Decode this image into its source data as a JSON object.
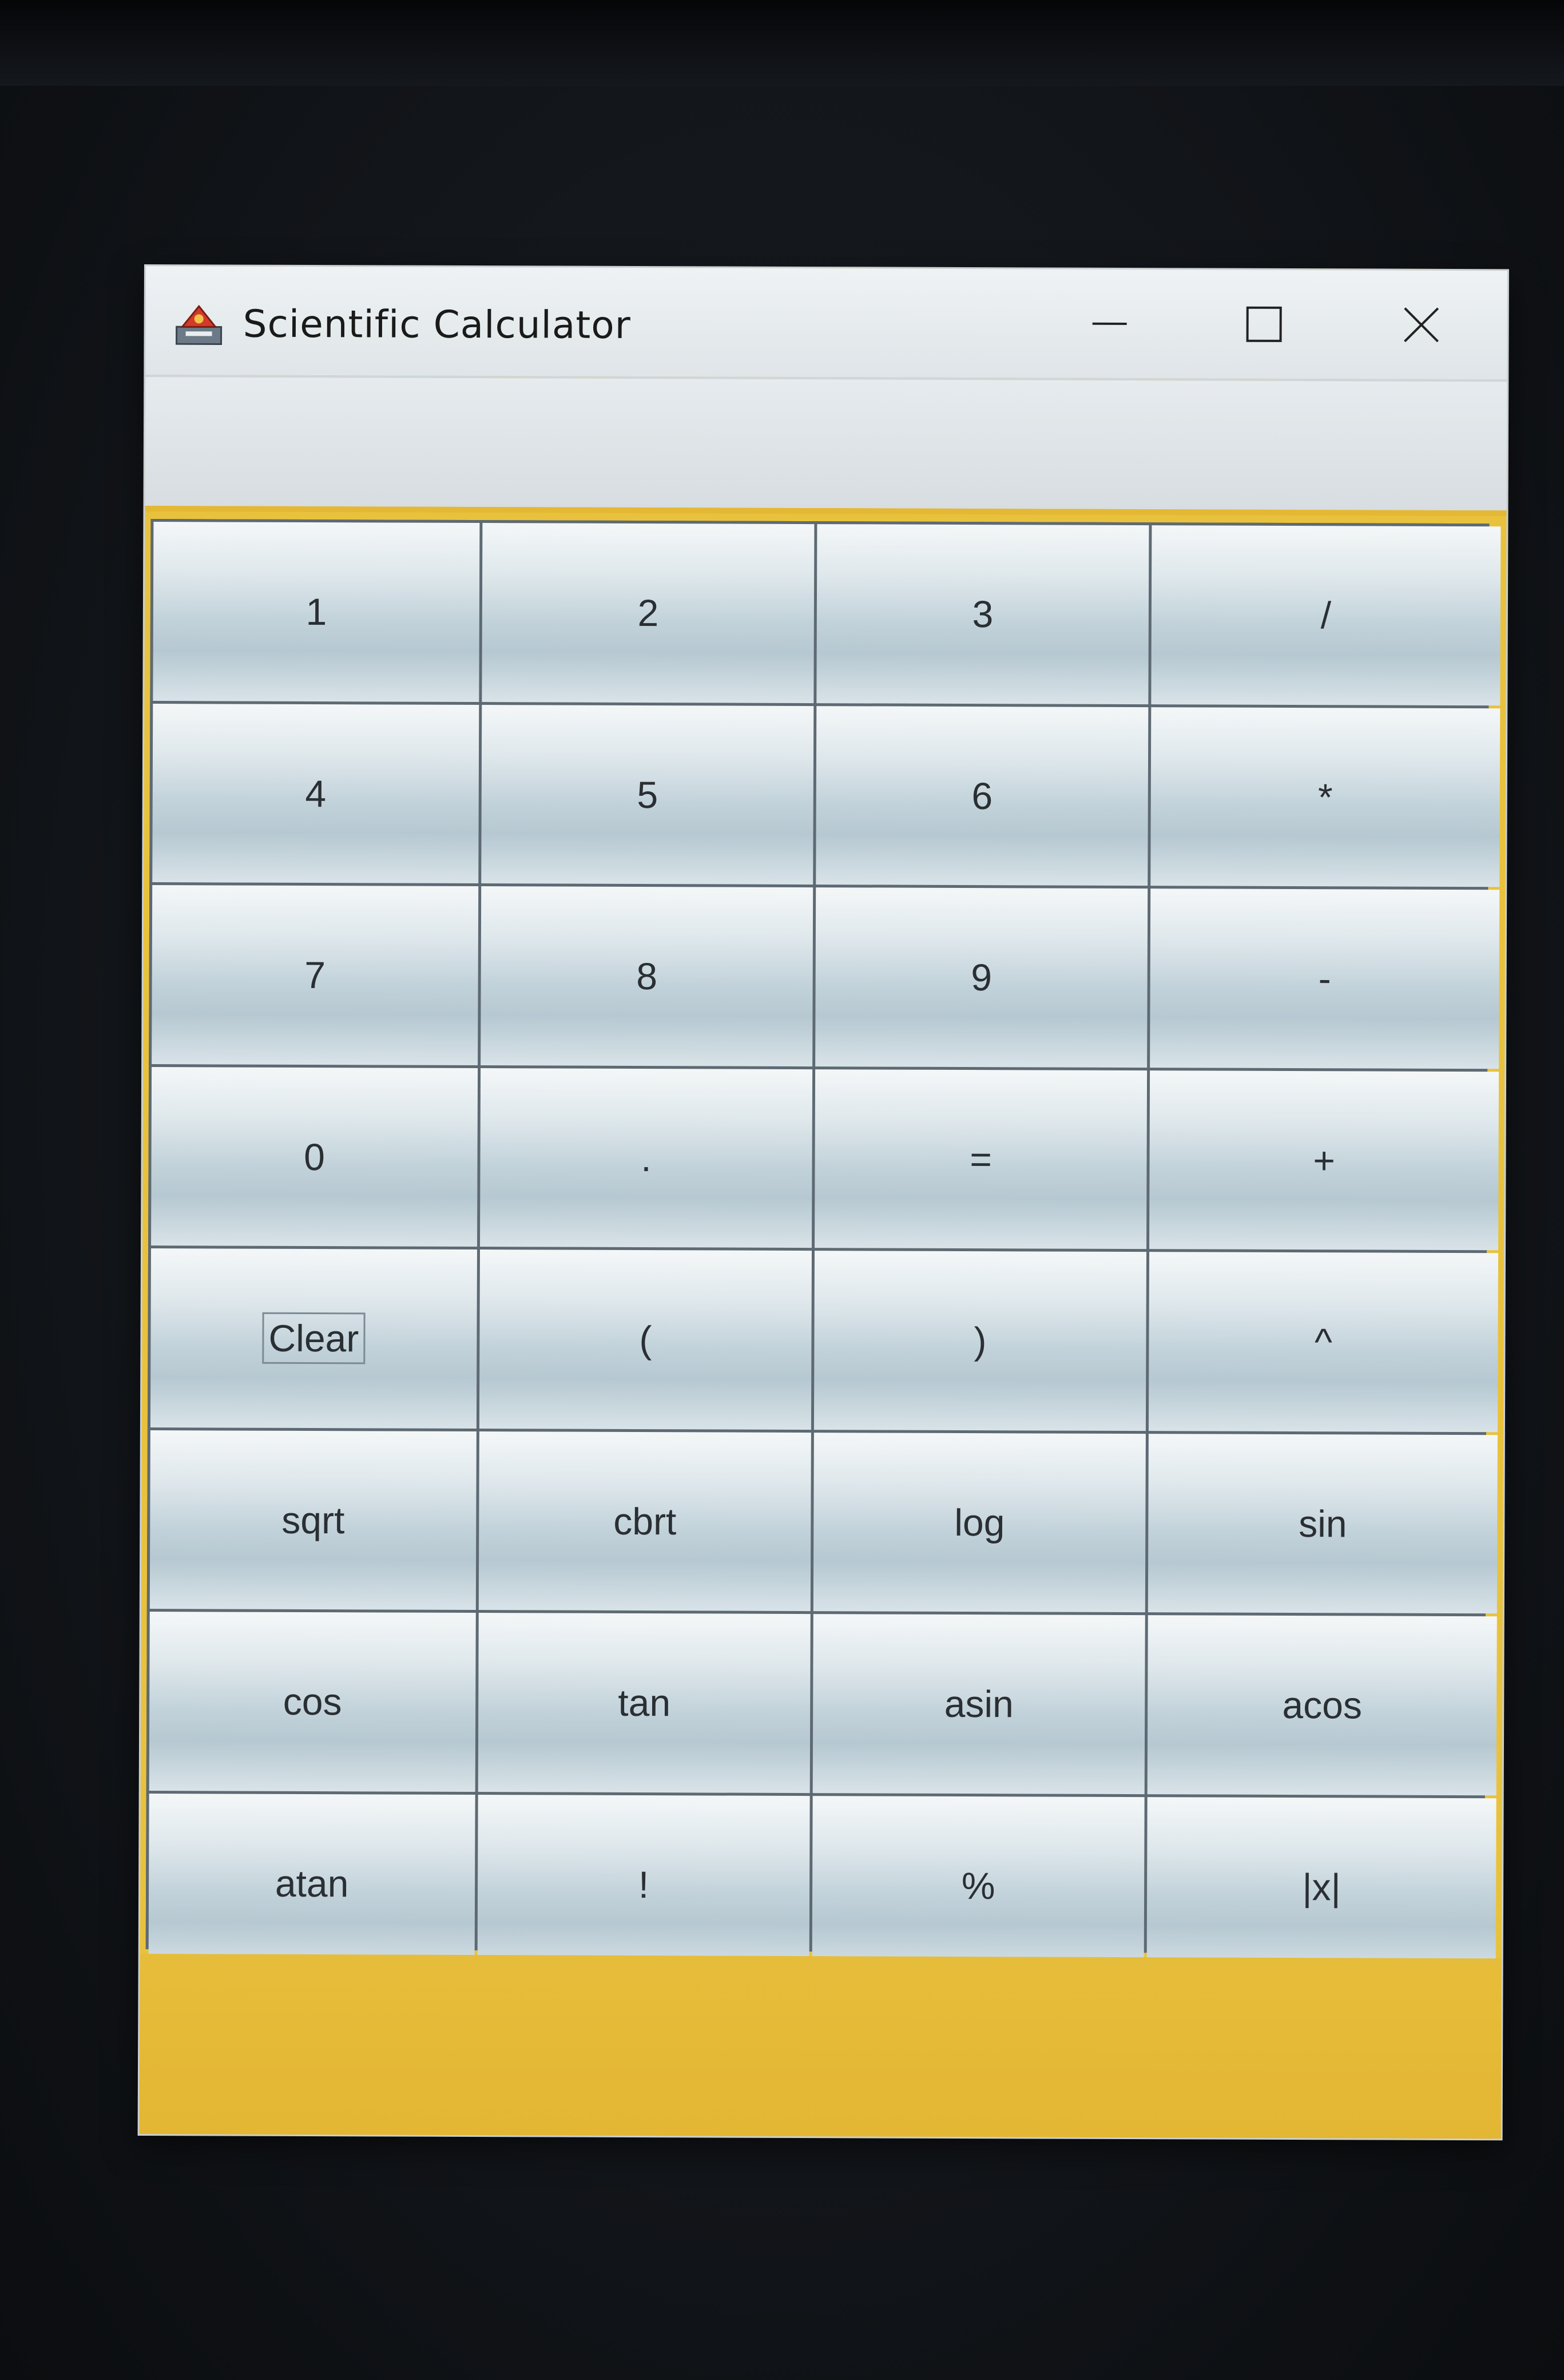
{
  "window": {
    "title": "Scientific Calculator",
    "display_value": ""
  },
  "titlebar_controls": {
    "minimize_icon": "minimize-icon",
    "maximize_icon": "maximize-icon",
    "close_icon": "close-icon"
  },
  "colors": {
    "frame_accent": "#e9c23d",
    "button_top": "#f4f7f8",
    "button_bottom": "#b6c8d1",
    "grid_lines": "#5e6a73"
  },
  "buttons": [
    "1",
    "2",
    "3",
    "/",
    "4",
    "5",
    "6",
    "*",
    "7",
    "8",
    "9",
    "-",
    "0",
    ".",
    "=",
    "+",
    "Clear",
    "(",
    ")",
    "^",
    "sqrt",
    "cbrt",
    "log",
    "sin",
    "cos",
    "tan",
    "asin",
    "acos",
    "atan",
    "!",
    "%",
    "|x|"
  ],
  "focused_button": "Clear"
}
